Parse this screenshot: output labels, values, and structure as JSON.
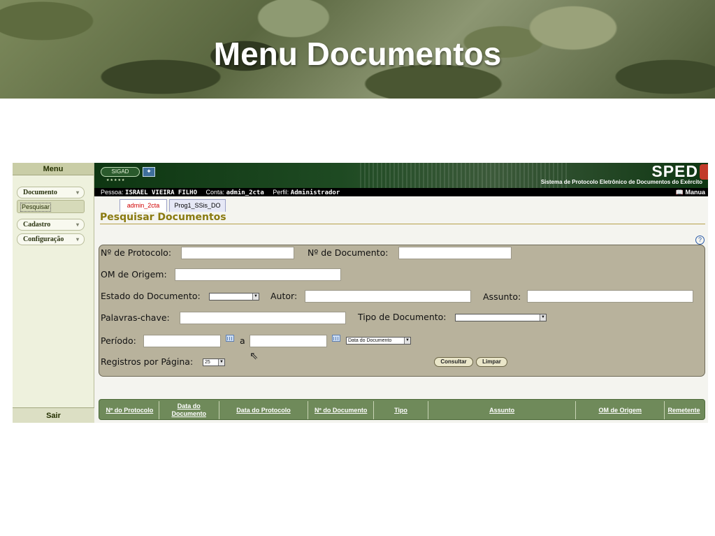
{
  "slide": {
    "title": "Menu Documentos"
  },
  "sidebar": {
    "header": "Menu",
    "groups": [
      {
        "label": "Documento"
      },
      {
        "label": "Cadastro"
      },
      {
        "label": "Configuração"
      }
    ],
    "sub_item": "Pesquisar",
    "logout": "Sair",
    "chevron": "▾"
  },
  "app": {
    "logo_text": "SIGAD",
    "brand": "SPED",
    "brand_subtitle": "Sistema de Protocolo Eletrônico de Documentos do Exército",
    "manual": "Manua"
  },
  "user_bar": {
    "person_label": "Pessoa:",
    "person": "ISRAEL VIEIRA FILHO",
    "account_label": "Conta:",
    "account": "admin_2cta",
    "profile_label": "Perfil:",
    "profile": "Administrador"
  },
  "tabs": [
    {
      "label": "admin_2cta",
      "active": true
    },
    {
      "label": "Prog1_SSis_DO",
      "active": false
    }
  ],
  "page": {
    "title": "Pesquisar Documentos",
    "help": "?"
  },
  "form": {
    "protocol_label": "Nº de Protocolo:",
    "document_number_label": "Nº de Documento:",
    "origin_label": "OM de Origem:",
    "state_label": "Estado do Documento:",
    "author_label": "Autor:",
    "subject_label": "Assunto:",
    "keywords_label": "Palavras-chave:",
    "doc_type_label": "Tipo de Documento:",
    "period_label": "Período:",
    "period_sep": "a",
    "date_type_selected": "Data do Documento",
    "records_label": "Registros por Página:",
    "records_selected": "25",
    "consult_button": "Consultar",
    "clear_button": "Limpar"
  },
  "results": {
    "columns": [
      {
        "label": "Nº do Protocolo"
      },
      {
        "label": "Data do Documento"
      },
      {
        "label": "Data do Protocolo"
      },
      {
        "label": "Nº do Documento"
      },
      {
        "label": "Tipo"
      },
      {
        "label": "Assunto"
      },
      {
        "label": "OM de Origem"
      },
      {
        "label": "Remetente"
      }
    ]
  },
  "colors": {
    "header_green": "#0e3612",
    "form_panel": "#b8b29c",
    "table_header": "#6f8a5a",
    "title_olive": "#8a7a10",
    "active_tab": "#d00000"
  }
}
